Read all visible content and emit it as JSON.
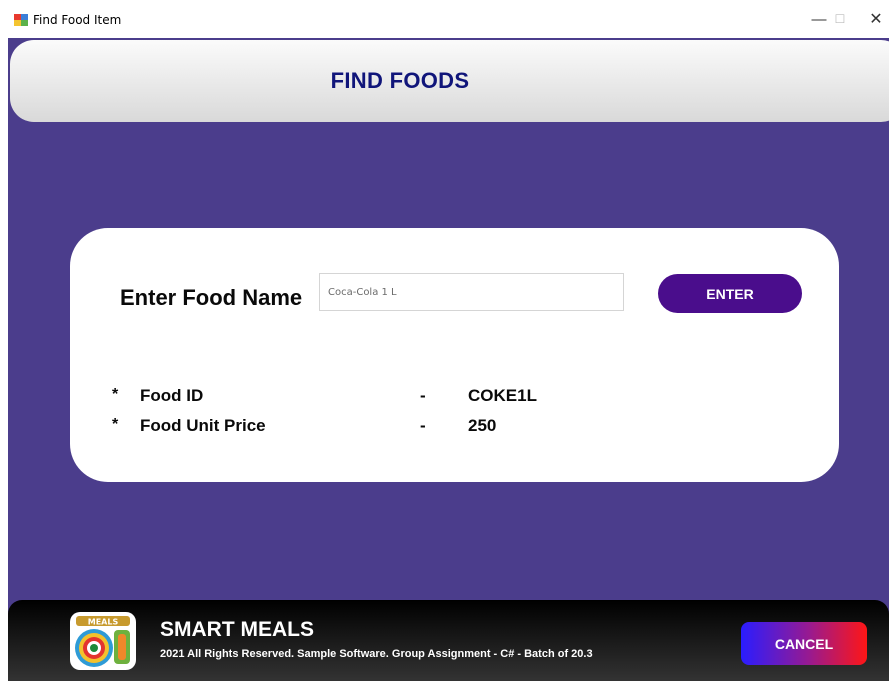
{
  "window": {
    "title": "Find Food Item",
    "controls": {
      "minimize": "—",
      "maximize": "☐",
      "close": "✕"
    }
  },
  "header": {
    "title": "FIND FOODS"
  },
  "search": {
    "label": "Enter Food Name",
    "input_value": "Coca-Cola 1 L",
    "button_label": "ENTER"
  },
  "result": {
    "bullet": "*",
    "separator": "-",
    "rows": [
      {
        "label": "Food ID",
        "value": "COKE1L"
      },
      {
        "label": "Food Unit Price",
        "value": "250"
      }
    ]
  },
  "footer": {
    "brand": "SMART MEALS",
    "copyright": "2021 All Rights Reserved.  Sample Software. Group Assignment - C# - Batch of 20.3",
    "cancel_label": "CANCEL",
    "logo_text": "MEALS"
  },
  "colors": {
    "background": "#4b3d8c",
    "header_title": "#10157a",
    "enter_button": "#4a0d8c"
  }
}
